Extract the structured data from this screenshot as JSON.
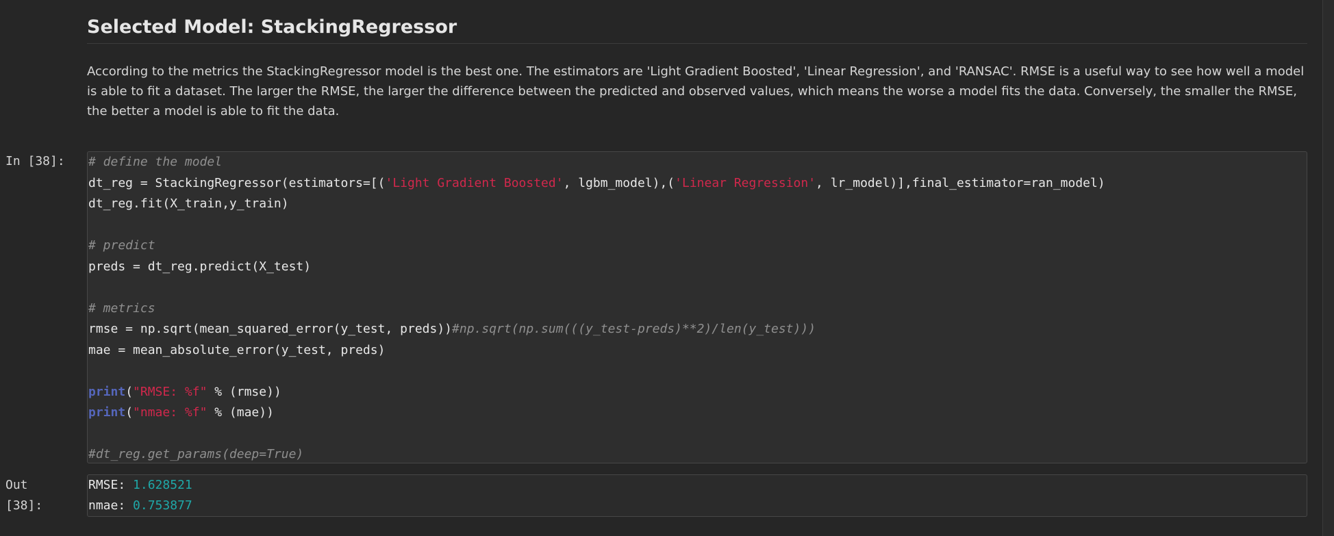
{
  "markdown": {
    "heading": "Selected Model: StackingRegressor",
    "paragraph": "According to the metrics the StackingRegressor model is the best one. The estimators are 'Light Gradient Boosted', 'Linear Regression', and 'RANSAC'. RMSE is a useful way to see how well a model is able to fit a dataset. The larger the RMSE, the larger the difference between the predicted and observed values, which means the worse a model fits the data. Conversely, the smaller the RMSE, the better a model is able to fit the data."
  },
  "input_cell": {
    "prompt": "In [38]:",
    "lines": {
      "l1_comment": "# define the model",
      "l2_a": "dt_reg = StackingRegressor(estimators=[(",
      "l2_str1": "'Light Gradient Boosted'",
      "l2_b": ", lgbm_model),(",
      "l2_str2": "'Linear Regression'",
      "l2_c": ", lr_model)],final_estimator=ran_model)",
      "l3": "dt_reg.fit(X_train,y_train)",
      "l5_comment": "# predict",
      "l6": "preds = dt_reg.predict(X_test)",
      "l8_comment": "# metrics",
      "l9_code": "rmse = np.sqrt(mean_squared_error(y_test, preds))",
      "l9_comment": "#np.sqrt(np.sum(((y_test-preds)**2)/len(y_test)))",
      "l10": "mae = mean_absolute_error(y_test, preds)",
      "l12_kw": "print",
      "l12_open": "(",
      "l12_str": "\"RMSE: %f\"",
      "l12_rest": " % (rmse))",
      "l13_kw": "print",
      "l13_open": "(",
      "l13_str": "\"nmae: %f\"",
      "l13_rest": " % (mae))",
      "l15_comment": "#dt_reg.get_params(deep=True)"
    }
  },
  "output_cell": {
    "prompt_line1": "Out",
    "prompt_line2": "[38]:",
    "rmse_label": "RMSE: ",
    "rmse_value": "1.628521",
    "nmae_label": "nmae: ",
    "nmae_value": "0.753877"
  },
  "colors": {
    "background": "#262626",
    "string": "#d0284c",
    "keyword": "#5566bb",
    "number": "#1fa8a8",
    "comment": "#8f8f8f"
  }
}
